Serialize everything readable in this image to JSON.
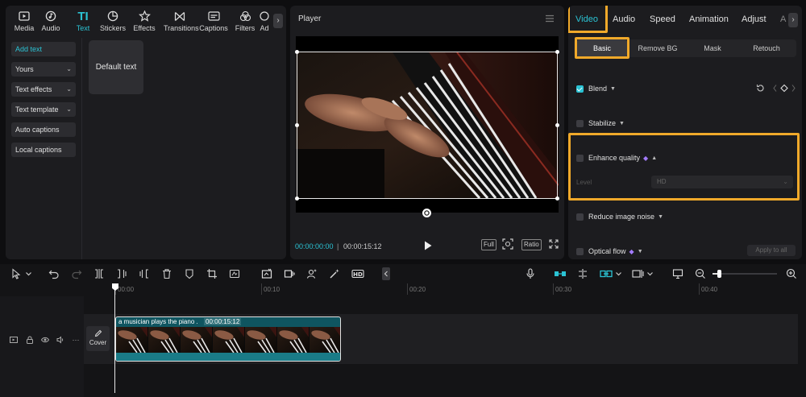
{
  "left_panel": {
    "tools": [
      {
        "label": "Media",
        "icon": "media-icon"
      },
      {
        "label": "Audio",
        "icon": "audio-icon"
      },
      {
        "label": "Text",
        "icon": "text-icon"
      },
      {
        "label": "Stickers",
        "icon": "stickers-icon"
      },
      {
        "label": "Effects",
        "icon": "effects-icon"
      },
      {
        "label": "Transitions",
        "icon": "transitions-icon"
      },
      {
        "label": "Captions",
        "icon": "captions-icon"
      },
      {
        "label": "Filters",
        "icon": "filters-icon"
      },
      {
        "label": "Ad",
        "icon": "adjust-icon"
      }
    ],
    "active_tool": "Text",
    "sidebar": [
      "Add text",
      "Yours",
      "Text effects",
      "Text template",
      "Auto captions",
      "Local captions"
    ],
    "default_text_card": "Default text"
  },
  "player": {
    "title": "Player",
    "time_current": "00:00:00:00",
    "time_separator": "|",
    "time_total": "00:00:15:12",
    "full_label": "Full",
    "ratio_label": "Ratio"
  },
  "right_panel": {
    "tabs": [
      "Video",
      "Audio",
      "Speed",
      "Animation",
      "Adjust",
      "A"
    ],
    "active_tab": "Video",
    "subtabs": [
      "Basic",
      "Remove BG",
      "Mask",
      "Retouch"
    ],
    "active_subtab": "Basic",
    "sections": [
      {
        "label": "Blend",
        "checked": true
      },
      {
        "label": "Stabilize",
        "checked": false
      },
      {
        "label": "Enhance quality",
        "checked": false
      },
      {
        "label": "Reduce image noise",
        "checked": false
      },
      {
        "label": "Optical flow",
        "checked": false
      }
    ],
    "level_label": "Level",
    "level_value": "HD",
    "apply_all": "Apply to all"
  },
  "timeline": {
    "ticks": [
      "00:00",
      "00:10",
      "00:20",
      "00:30",
      "00:40"
    ],
    "cover_label": "Cover",
    "clip_label": "a musician plays the piano .",
    "clip_duration": "00:00:15:12"
  },
  "colors": {
    "accent": "#2bc3d4",
    "highlight": "#f0a92a",
    "panel": "#1c1c1f",
    "background": "#0e0e10",
    "clip": "#0f5560"
  }
}
